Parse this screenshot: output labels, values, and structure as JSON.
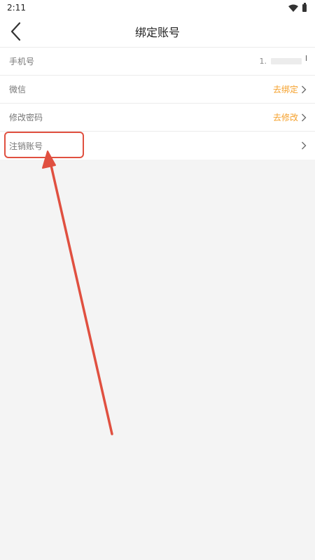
{
  "status_bar": {
    "time": "2:11"
  },
  "header": {
    "title": "绑定账号"
  },
  "rows": [
    {
      "label": "手机号",
      "value": "1.",
      "action": ""
    },
    {
      "label": "微信",
      "value": "",
      "action": "去绑定"
    },
    {
      "label": "修改密码",
      "value": "",
      "action": "去修改"
    },
    {
      "label": "注销账号",
      "value": "",
      "action": ""
    }
  ],
  "colors": {
    "accent": "#f5a02a",
    "annotation": "#e05040",
    "background": "#f4f4f4"
  },
  "icons": [
    "back-arrow-icon",
    "wifi-icon",
    "battery-icon",
    "chevron-right-icon"
  ]
}
